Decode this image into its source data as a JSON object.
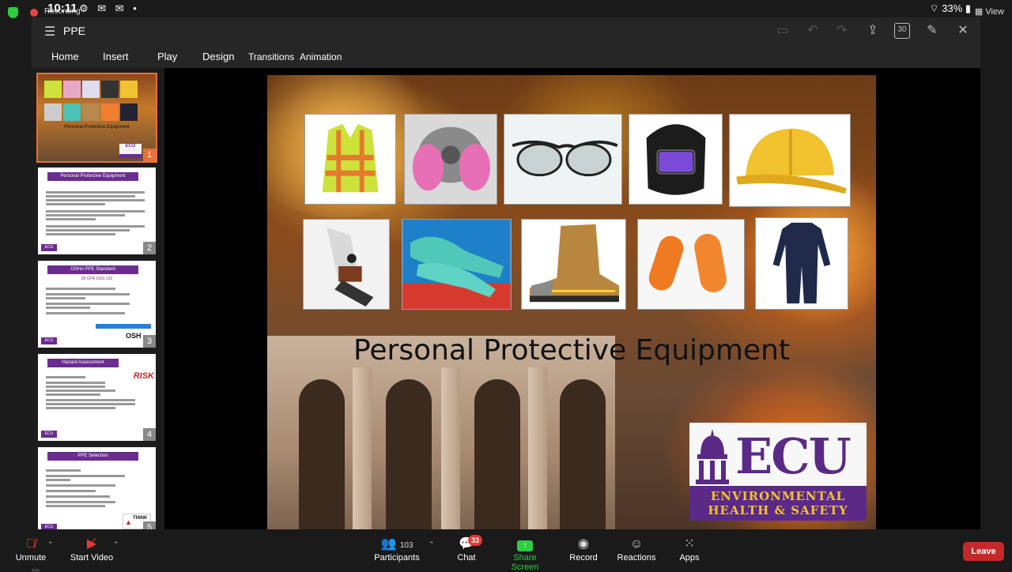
{
  "status_bar": {
    "time": "10:11",
    "recording_label": "Recording",
    "battery": "33%",
    "view_label": "View"
  },
  "window": {
    "title": "PPE"
  },
  "ribbon": {
    "tabs": [
      "Home",
      "Insert",
      "Play",
      "Design",
      "Transitions",
      "Animation"
    ]
  },
  "thumbnails": [
    {
      "number": "1",
      "title": "Personal Protective Equipment",
      "active": true
    },
    {
      "number": "2",
      "title": "Personal Protective Equipment",
      "active": false
    },
    {
      "number": "3",
      "title": "OSHA PPE Standard",
      "subtitle": "29 CFR 1910.132",
      "active": false
    },
    {
      "number": "4",
      "title": "Hazard Assessment",
      "badge": "RISK",
      "active": false
    },
    {
      "number": "5",
      "title": "PPE Selection",
      "badge": "THINK",
      "active": false
    }
  ],
  "slide": {
    "title": "Personal Protective Equipment",
    "logo_letters": "ECU",
    "logo_line1": "ENVIRONMENTAL",
    "logo_line2": "HEALTH & SAFETY"
  },
  "toolbar": {
    "unmute": "Unmute",
    "start_video": "Start Video",
    "participants": "Participants",
    "participants_count": "103",
    "chat": "Chat",
    "chat_badge": "33",
    "share_screen": "Share Screen",
    "record": "Record",
    "reactions": "Reactions",
    "apps": "Apps",
    "leave": "Leave"
  },
  "colors": {
    "accent_orange": "#e8703a",
    "ecu_purple": "#5a2a86",
    "ecu_gold": "#f1c232",
    "share_green": "#2ecc40",
    "leave_red": "#c62828"
  }
}
